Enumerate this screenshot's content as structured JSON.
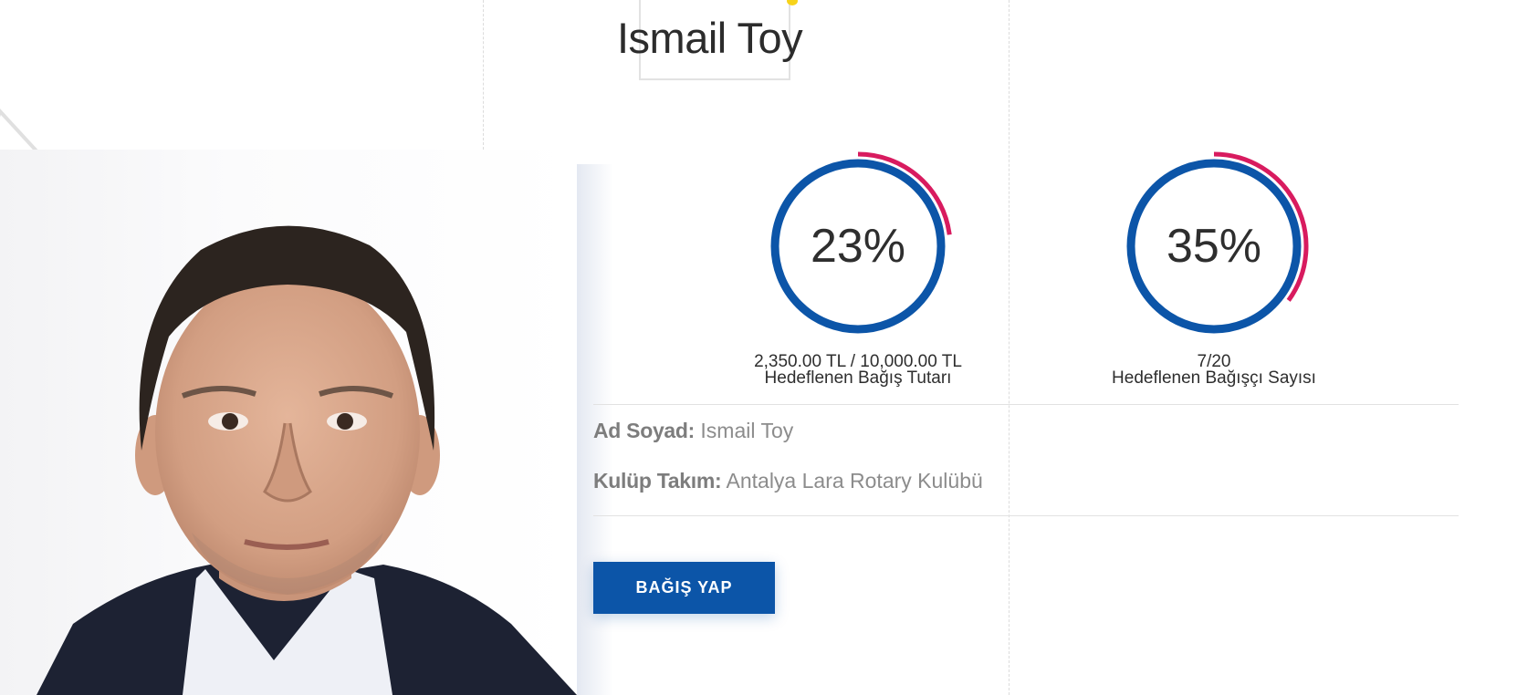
{
  "title": "Ismail Toy",
  "gauges": [
    {
      "percent": 0.23,
      "percent_label": "23%",
      "amount_text": "2,350.00 TL / 10,000.00 TL",
      "caption": "Hedeflenen Bağış Tutarı"
    },
    {
      "percent": 0.35,
      "percent_label": "35%",
      "amount_text": "7/20",
      "caption": "Hedeflenen Bağışçı Sayısı"
    }
  ],
  "info": {
    "name_label": "Ad Soyad:",
    "name_value": "Ismail Toy",
    "club_label": "Kulüp Takım:",
    "club_value": "Antalya Lara Rotary Kulübü"
  },
  "donate_button": "BAĞIŞ YAP",
  "colors": {
    "ring": "#0c55a8",
    "progress": "#d81b5f",
    "button": "#0c55a8",
    "accent_dot": "#f7d31a"
  }
}
